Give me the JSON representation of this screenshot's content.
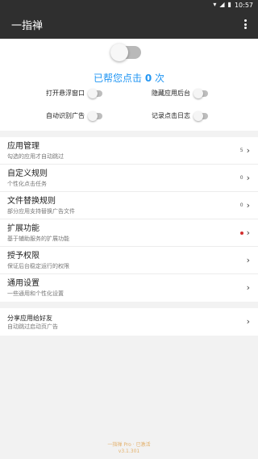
{
  "status_bar": {
    "time": "10:57",
    "icons": [
      "wifi-icon",
      "signal-icon",
      "battery-icon"
    ]
  },
  "app_bar": {
    "title": "一指禅",
    "menu_icon": "more-vert-icon"
  },
  "main": {
    "counter_prefix": "已帮您点击",
    "counter_value": "0",
    "counter_suffix": "次",
    "main_switch_on": false
  },
  "options": {
    "floating_window": "打开悬浮窗口",
    "hide_background": "隐藏应用后台",
    "auto_detect_ads": "自动识别广告",
    "log_clicks": "记录点击日志"
  },
  "list": [
    {
      "title": "应用管理",
      "subtitle": "勾选的应用才自动跳过",
      "count": "5"
    },
    {
      "title": "自定义规则",
      "subtitle": "个性化点击任务",
      "count": "0"
    },
    {
      "title": "文件替换规则",
      "subtitle": "部分应用支持替换广告文件",
      "count": "0"
    },
    {
      "title": "扩展功能",
      "subtitle": "基于辅助服务的扩展功能",
      "badge": true
    },
    {
      "title": "授予权限",
      "subtitle": "保证后台稳定运行的权限"
    },
    {
      "title": "通用设置",
      "subtitle": "一些通用和个性化设置"
    }
  ],
  "share": {
    "title": "分享应用给好友",
    "subtitle": "自动跳过启动页广告"
  },
  "footer": {
    "line1": "一指禅 Pro · 已激活",
    "line2": "v3.1.301"
  },
  "colors": {
    "accent": "#2196f3",
    "appbar": "#2f2f2f",
    "badge": "#d32f2f",
    "footer": "#e3b06b"
  }
}
